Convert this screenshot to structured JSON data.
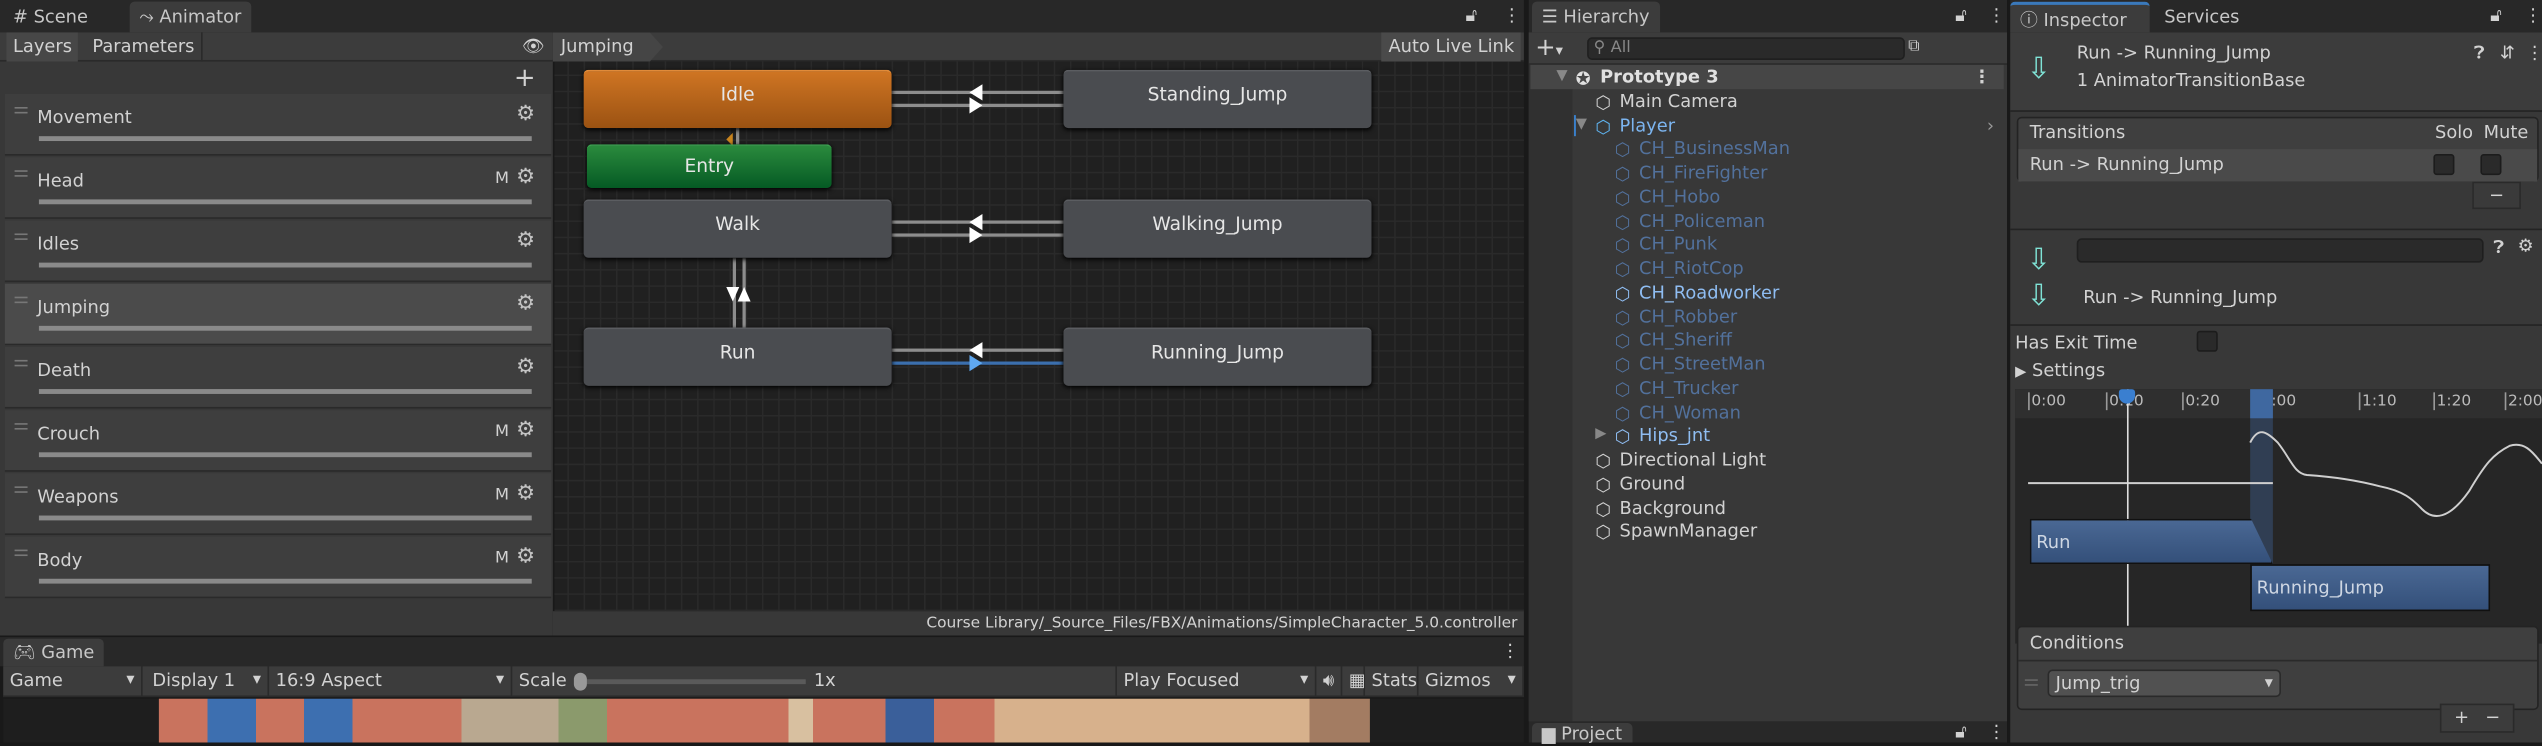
{
  "top_tabs": {
    "scene": "Scene",
    "animator": "Animator"
  },
  "animator": {
    "tabs": {
      "layers": "Layers",
      "parameters": "Parameters"
    },
    "breadcrumb": "Jumping",
    "auto_live_link": "Auto Live Link",
    "layers": [
      {
        "name": "Movement",
        "mask": false,
        "selected": false
      },
      {
        "name": "Head",
        "mask": true,
        "selected": false
      },
      {
        "name": "Idles",
        "mask": false,
        "selected": false
      },
      {
        "name": "Jumping",
        "mask": false,
        "selected": true
      },
      {
        "name": "Death",
        "mask": false,
        "selected": false
      },
      {
        "name": "Crouch",
        "mask": true,
        "selected": false
      },
      {
        "name": "Weapons",
        "mask": true,
        "selected": false
      },
      {
        "name": "Body",
        "mask": true,
        "selected": false
      }
    ],
    "mask_label": "M",
    "states": {
      "idle": "Idle",
      "entry": "Entry",
      "walk": "Walk",
      "run": "Run",
      "standing_jump": "Standing_Jump",
      "walking_jump": "Walking_Jump",
      "running_jump": "Running_Jump"
    },
    "controller_path": "Course Library/_Source_Files/FBX/Animations/SimpleCharacter_5.0.controller",
    "colors": {
      "default_state": "#c8701e",
      "entry": "#1f7a33",
      "selected_transition": "#4a90d9"
    }
  },
  "game": {
    "tab": "Game",
    "toolbar": {
      "mode": "Game",
      "display": "Display 1",
      "aspect": "16:9 Aspect",
      "scale_label": "Scale",
      "scale_value": "1x",
      "scale_fraction": 0,
      "play_mode": "Play Focused",
      "stats": "Stats",
      "gizmos": "Gizmos"
    }
  },
  "hierarchy": {
    "tab": "Hierarchy",
    "search_placeholder": "All",
    "items": [
      {
        "name": "Prototype 3",
        "depth": 0,
        "kind": "scene",
        "expanded": true
      },
      {
        "name": "Main Camera",
        "depth": 1,
        "kind": "object"
      },
      {
        "name": "Player",
        "depth": 1,
        "kind": "prefab",
        "expanded": true
      },
      {
        "name": "CH_BusinessMan",
        "depth": 2,
        "kind": "inactive"
      },
      {
        "name": "CH_FireFighter",
        "depth": 2,
        "kind": "inactive"
      },
      {
        "name": "CH_Hobo",
        "depth": 2,
        "kind": "inactive"
      },
      {
        "name": "CH_Policeman",
        "depth": 2,
        "kind": "inactive"
      },
      {
        "name": "CH_Punk",
        "depth": 2,
        "kind": "inactive"
      },
      {
        "name": "CH_RiotCop",
        "depth": 2,
        "kind": "inactive"
      },
      {
        "name": "CH_Roadworker",
        "depth": 2,
        "kind": "prefab-child"
      },
      {
        "name": "CH_Robber",
        "depth": 2,
        "kind": "inactive"
      },
      {
        "name": "CH_Sheriff",
        "depth": 2,
        "kind": "inactive"
      },
      {
        "name": "CH_StreetMan",
        "depth": 2,
        "kind": "inactive"
      },
      {
        "name": "CH_Trucker",
        "depth": 2,
        "kind": "inactive"
      },
      {
        "name": "CH_Woman",
        "depth": 2,
        "kind": "inactive"
      },
      {
        "name": "Hips_jnt",
        "depth": 2,
        "kind": "prefab-child",
        "collapsed": true
      },
      {
        "name": "Directional Light",
        "depth": 1,
        "kind": "object"
      },
      {
        "name": "Ground",
        "depth": 1,
        "kind": "object"
      },
      {
        "name": "Background",
        "depth": 1,
        "kind": "object"
      },
      {
        "name": "SpawnManager",
        "depth": 1,
        "kind": "object"
      }
    ],
    "project_tab": "Project"
  },
  "inspector": {
    "tabs": {
      "inspector": "Inspector",
      "services": "Services"
    },
    "title": "Run -> Running_Jump",
    "subtitle": "1 AnimatorTransitionBase",
    "transitions": {
      "header": "Transitions",
      "solo": "Solo",
      "mute": "Mute",
      "rows": [
        {
          "name": "Run -> Running_Jump",
          "solo": false,
          "mute": false
        }
      ]
    },
    "transition_name_value": "",
    "transition_label": "Run -> Running_Jump",
    "has_exit_time_label": "Has Exit Time",
    "has_exit_time": false,
    "settings_label": "Settings",
    "timeline": {
      "ticks": [
        "0:00",
        "0:10",
        "0:20",
        "1:00",
        "1:10",
        "1:20",
        "2:00"
      ],
      "source_clip": "Run",
      "dest_clip": "Running_Jump"
    },
    "conditions": {
      "header": "Conditions",
      "items": [
        {
          "parameter": "Jump_trig"
        }
      ]
    }
  }
}
